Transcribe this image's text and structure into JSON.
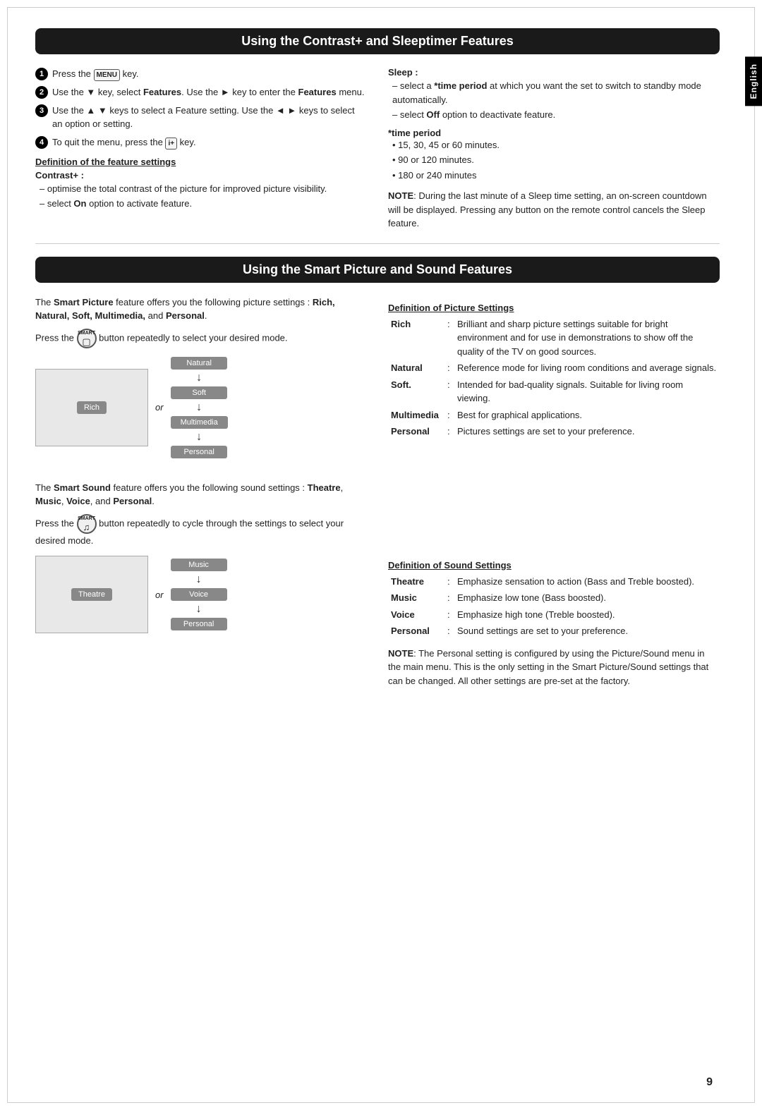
{
  "page": {
    "number": "9",
    "lang_tab": "English"
  },
  "section1": {
    "title": "Using the Contrast+ and Sleeptimer Features",
    "steps": [
      {
        "num": "1",
        "text": "Press the MENU key."
      },
      {
        "num": "2",
        "text": "Use the ▼ key, select Features. Use the ► key to enter the Features menu."
      },
      {
        "num": "3",
        "text": "Use the ▲ ▼ keys to select a Feature setting. Use the ◄ ► keys to select an option or setting."
      },
      {
        "num": "4",
        "text": "To quit the menu, press the ⊞ key."
      }
    ],
    "def_heading": "Definition of the feature settings",
    "contrast_plus_heading": "Contrast+ :",
    "contrast_plus_items": [
      "optimise the total contrast of the picture for improved picture visibility.",
      "select On option to activate feature."
    ],
    "sleep_heading": "Sleep :",
    "sleep_items": [
      "select a *time period at which you want the set to switch to standby mode automatically.",
      "select Off option to deactivate feature."
    ],
    "time_period_heading": "*time period",
    "time_period_items": [
      "15, 30, 45 or 60 minutes.",
      "90 or 120 minutes.",
      "180 or 240 minutes"
    ],
    "note_label": "NOTE",
    "note_text": ": During the last minute of a Sleep time setting, an on-screen countdown will be displayed. Pressing any button on the remote control cancels the Sleep feature."
  },
  "section2": {
    "title": "Using the Smart Picture and Sound Features",
    "smart_picture_intro": "The Smart Picture feature offers you the following picture settings : Rich, Natural, Soft, Multimedia, and Personal.",
    "smart_picture_press": "Press the",
    "smart_picture_press2": "button repeatedly to select your desired mode.",
    "diagram_picture": {
      "left_label": "Rich",
      "or": "or",
      "flow": [
        "Natural",
        "Soft",
        "Multimedia",
        "Personal"
      ]
    },
    "def_picture_heading": "Definition of Picture Settings",
    "picture_settings": [
      {
        "name": "Rich",
        "colon": ":",
        "desc": "Brilliant and sharp picture settings suitable for bright environment and for use in demonstrations to show off the quality of the TV on good sources."
      },
      {
        "name": "Natural",
        "colon": ":",
        "desc": "Reference mode for living room conditions and average signals."
      },
      {
        "name": "Soft.",
        "colon": ":",
        "desc": "Intended for bad-quality signals. Suitable for living room viewing."
      },
      {
        "name": "Multimedia",
        "colon": ":",
        "desc": "Best for graphical applications."
      },
      {
        "name": "Personal",
        "colon": ":",
        "desc": "Pictures settings are set to your preference."
      }
    ],
    "smart_sound_intro": "The Smart Sound feature offers you the following sound settings : Theatre, Music, Voice, and Personal.",
    "smart_sound_press": "Press the",
    "smart_sound_press2": "button repeatedly to cycle through the settings to select your desired mode.",
    "diagram_sound": {
      "left_label": "Theatre",
      "or": "or",
      "flow": [
        "Music",
        "Voice",
        "Personal"
      ]
    },
    "def_sound_heading": "Definition of Sound Settings",
    "sound_settings": [
      {
        "name": "Theatre",
        "colon": ":",
        "desc": "Emphasize sensation to action (Bass and Treble boosted)."
      },
      {
        "name": "Music",
        "colon": ":",
        "desc": "Emphasize low tone (Bass boosted)."
      },
      {
        "name": "Voice",
        "colon": ":",
        "desc": "Emphasize high tone (Treble boosted)."
      },
      {
        "name": "Personal",
        "colon": ":",
        "desc": "Sound settings are set to your preference."
      }
    ],
    "note_label": "NOTE",
    "note_text": ": The Personal setting is configured by using the Picture/Sound menu in the main menu. This is the only setting in the Smart Picture/Sound settings that can be changed. All other settings are pre-set at the factory."
  }
}
